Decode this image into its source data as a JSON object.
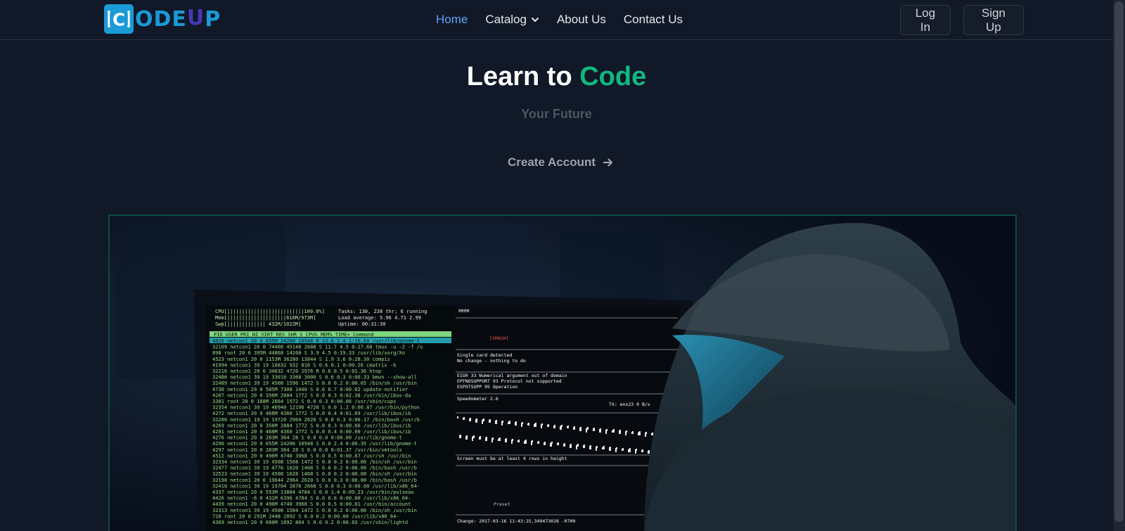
{
  "brand": {
    "logo_icon_letter": "C",
    "logo_text_start": "ODE",
    "logo_text_u": "U",
    "logo_text_end": "P",
    "primary_color": "#1a9ad6",
    "secondary_color": "#4638b6"
  },
  "nav": {
    "items": [
      {
        "label": "Home",
        "active": true
      },
      {
        "label": "Catalog",
        "has_dropdown": true
      },
      {
        "label": "About Us"
      },
      {
        "label": "Contact Us"
      }
    ],
    "active_color": "#60a5fa"
  },
  "auth": {
    "login_label": "Log In",
    "signup_label": "Sign Up"
  },
  "hero": {
    "title_part1": "Learn to ",
    "title_accent": "Code",
    "accent_color": "#10b981",
    "subtitle": "Your Future",
    "cta_label": "Create Account",
    "cta_icon": "arrow-right-icon",
    "image_subject": "hooded-person-at-terminal-screen"
  },
  "terminal": {
    "header_lines": [
      "CPU[||||||||||||||||||||||||||100.0%]",
      "Mem[||||||||||||||||||||616M/973M]",
      "Swp[|||||||||||||     432M/1022M]"
    ],
    "stats": [
      "Tasks: 130, 238 thr; 6 running",
      "Load average: 5.96 4.71 2.99",
      "Uptime: 00:31:30"
    ],
    "columns": "PID USER     PRI  NI  VIRT   RES   SHR S CPU% MEM%   TIME+  Command",
    "rows": [
      "4826 netcon1   20   0  655M 24200 10948 R 13.6  2.4  1:16.69 /usr/lib/gnome-t",
      "32109 netcon1   20   0 74400 45148  2688 S 11.7  4.5  0:27.68 tmux -u -2 -f /u",
      " 898 root      20   0  395M 44868 14160 S  3.9  4.5  0:19.33 /usr/lib/xorg/Xo",
      "4523 netcon1   20   0 1153M 36280 13844 S  1.9  3.6  0:28.30 compiz",
      "41994 netcon1   39  19 10832   932   816 S  0.6  0.1  0:00.26 cmatrix -b",
      "32216 netcon1   20   0 34032  4720  2976 R  0.6  0.5  0:01.36 htop",
      "32486 netcon1   39  19 33016  3368  3000 S  0.6  0.3  0:00.33 bmon --show-all",
      "32489 netcon1   39  19  4508  1596  1472 S  0.6  0.2  0:00.05 /bin/sh /usr/bin",
      "4730 netcon1   20   0  585M  7308  1440 S  0.6  0.7  0:00.02 update-notifier",
      "4207 netcon1   20   0  356M  2884  1772 S  0.0  0.3  0:02.38 /usr/bin/ibus-da",
      "3381 root      20   0  188M  2664  1572 S  0.0  0.3  0:00.06 /usr/sbin/cups",
      "32354 netcon1   39  19 40940 12196  4728 S  0.0  1.2  0:00.87 /usr/bin/python",
      "4272 netcon1   20   0  468M  4360  1772 S  0.0  0.4  0:01.69 /usr/lib/ibus/ib",
      "32286 netcon1   19  19 19720  2964  2620 S  0.0  0.3  0:00.17 /bin/bash /usr/b",
      "4269 netcon1   20   0  356M  2884  1772 S  0.0  0.3  0:00.66 /usr/lib/ibus/ib",
      "4281 netcon1   20   0  468M  4360  1772 S  0.0  0.4  0:00.00 /usr/lib/ibus/ib",
      "4276 netcon1   20   0  283M   364    28 S  0.0  0.0  0:00.00 /usr/lib/gnome-t",
      "4290 netcon1   20   0  655M 24200 10948 S  0.0  2.4  0:00.35 /usr/lib/gnome-t",
      "4297 netcon1   20   0  283M   364    28 S  0.0  0.0  0:01.37 /usr/bin/vmtools",
      "4512 netcon1   20   0  496M  4740  3968 S  0.0  0.5  0:00.87 /usr/sh /usr/bin",
      "32334 netcon1   39  19  4508  1508  1472 S  0.0  0.2  0:00.00 /bin/sh /usr/bin",
      "32477 netcon1   39  19  4776  1620  1408 S  0.0  0.2  0:00.00 /bin/bash /usr/b",
      "32523 netcon1   39  19  4508  1628  1468 S  0.0  0.2  0:00.08 /bin/sh /usr/bin",
      "32198 netcon1   20   0 19644  2964  2620 S  0.0  0.3  0:00.00 /bin/bash /usr/b",
      "32410 netcon1   39  19 19704  2876  2668 S  0.0  0.3  0:00.00 /usr/lib/x86_64-",
      "4337 netcon1   20   0  553M 13884  4784 S  0.0  1.4  0:09.23 /usr/bin/pulseau",
      "4426 netcon1   -6   0  431M  6396  4784 S  0.0  0.6  0:00.00 /usr/lib/x86_64-",
      "4439 netcon1   20   0  496M  4740  3968 S  0.0  0.5  0:00.01 /usr/bin/account",
      "32313 netcon1   39  19  4508  1584  1472 S  0.0  0.2  0:00.00 /bin/sh /usr/bin",
      " 720 root      20   0  291M  2448  2092 S  0.0  0.2  0:00.00 /usr/lib/x86_64-",
      "4369 netcon1   20   0  660M  1892   864 S  0.0  0.2  0:00.03 /usr/sbin/lightd"
    ],
    "right_panel": {
      "top": "0000",
      "smash": "[SMASH]",
      "card": "Single card detected",
      "change": "No change - nothing to do",
      "eio": "EIO0 33 Numerical argument out of domain",
      "epfnos": "EPFNOSUPPORT 93 Protocol not supported",
      "esp": "ESPOTSUPP 95 Operation",
      "speed": "Speedometer 2.6",
      "tx": "TX: enx23   0 B/s",
      "rows_msg": "Screen must be at least 4 rows in height",
      "preset": "Preset",
      "change_ts": "Change: 2017-03-16 11:43:25.349473028 -0700"
    }
  }
}
